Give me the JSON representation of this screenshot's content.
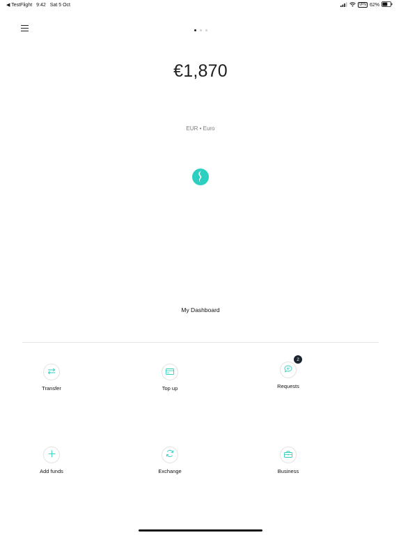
{
  "status_bar": {
    "back_app": "◀ TestFlight",
    "time": "9:42",
    "date": "Sat 5 Oct",
    "vpn": "VPN",
    "battery_percent": "62%",
    "battery_level": 0.62
  },
  "header": {
    "menu_icon": "hamburger-menu-icon",
    "page_count": 3,
    "active_page": 1
  },
  "balance": {
    "amount": "€1,870",
    "currency": "EUR • Euro"
  },
  "brand": {
    "logo_color": "#2ccfc0"
  },
  "dashboard": {
    "label": "My Dashboard"
  },
  "actions": [
    {
      "label": "Transfer",
      "icon": "transfer-arrows-icon"
    },
    {
      "label": "Top up",
      "icon": "card-icon"
    },
    {
      "label": "Requests",
      "icon": "chat-bubble-icon",
      "badge": "2"
    },
    {
      "label": "Add funds",
      "icon": "plus-icon"
    },
    {
      "label": "Exchange",
      "icon": "refresh-icon"
    },
    {
      "label": "Business",
      "icon": "briefcase-icon"
    }
  ],
  "colors": {
    "accent": "#2ccfc0",
    "text": "#1a1a1a",
    "muted": "#7a7a7a",
    "badge": "#1c2430"
  }
}
